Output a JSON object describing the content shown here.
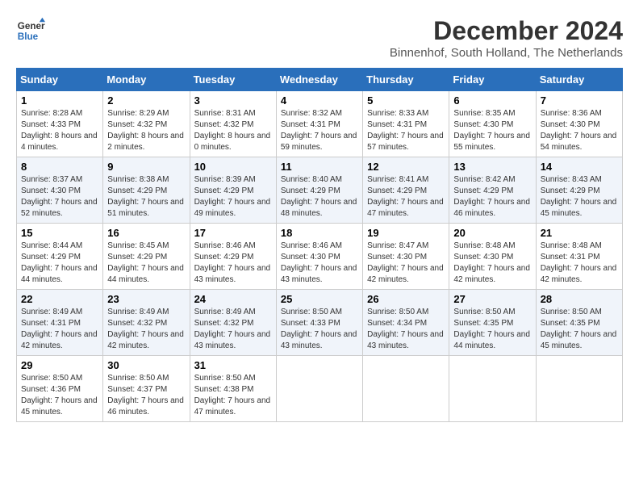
{
  "header": {
    "logo_line1": "General",
    "logo_line2": "Blue",
    "month_title": "December 2024",
    "location": "Binnenhof, South Holland, The Netherlands"
  },
  "weekdays": [
    "Sunday",
    "Monday",
    "Tuesday",
    "Wednesday",
    "Thursday",
    "Friday",
    "Saturday"
  ],
  "weeks": [
    [
      {
        "day": "1",
        "sunrise": "8:28 AM",
        "sunset": "4:33 PM",
        "daylight": "8 hours and 4 minutes."
      },
      {
        "day": "2",
        "sunrise": "8:29 AM",
        "sunset": "4:32 PM",
        "daylight": "8 hours and 2 minutes."
      },
      {
        "day": "3",
        "sunrise": "8:31 AM",
        "sunset": "4:32 PM",
        "daylight": "8 hours and 0 minutes."
      },
      {
        "day": "4",
        "sunrise": "8:32 AM",
        "sunset": "4:31 PM",
        "daylight": "7 hours and 59 minutes."
      },
      {
        "day": "5",
        "sunrise": "8:33 AM",
        "sunset": "4:31 PM",
        "daylight": "7 hours and 57 minutes."
      },
      {
        "day": "6",
        "sunrise": "8:35 AM",
        "sunset": "4:30 PM",
        "daylight": "7 hours and 55 minutes."
      },
      {
        "day": "7",
        "sunrise": "8:36 AM",
        "sunset": "4:30 PM",
        "daylight": "7 hours and 54 minutes."
      }
    ],
    [
      {
        "day": "8",
        "sunrise": "8:37 AM",
        "sunset": "4:30 PM",
        "daylight": "7 hours and 52 minutes."
      },
      {
        "day": "9",
        "sunrise": "8:38 AM",
        "sunset": "4:29 PM",
        "daylight": "7 hours and 51 minutes."
      },
      {
        "day": "10",
        "sunrise": "8:39 AM",
        "sunset": "4:29 PM",
        "daylight": "7 hours and 49 minutes."
      },
      {
        "day": "11",
        "sunrise": "8:40 AM",
        "sunset": "4:29 PM",
        "daylight": "7 hours and 48 minutes."
      },
      {
        "day": "12",
        "sunrise": "8:41 AM",
        "sunset": "4:29 PM",
        "daylight": "7 hours and 47 minutes."
      },
      {
        "day": "13",
        "sunrise": "8:42 AM",
        "sunset": "4:29 PM",
        "daylight": "7 hours and 46 minutes."
      },
      {
        "day": "14",
        "sunrise": "8:43 AM",
        "sunset": "4:29 PM",
        "daylight": "7 hours and 45 minutes."
      }
    ],
    [
      {
        "day": "15",
        "sunrise": "8:44 AM",
        "sunset": "4:29 PM",
        "daylight": "7 hours and 44 minutes."
      },
      {
        "day": "16",
        "sunrise": "8:45 AM",
        "sunset": "4:29 PM",
        "daylight": "7 hours and 44 minutes."
      },
      {
        "day": "17",
        "sunrise": "8:46 AM",
        "sunset": "4:29 PM",
        "daylight": "7 hours and 43 minutes."
      },
      {
        "day": "18",
        "sunrise": "8:46 AM",
        "sunset": "4:30 PM",
        "daylight": "7 hours and 43 minutes."
      },
      {
        "day": "19",
        "sunrise": "8:47 AM",
        "sunset": "4:30 PM",
        "daylight": "7 hours and 42 minutes."
      },
      {
        "day": "20",
        "sunrise": "8:48 AM",
        "sunset": "4:30 PM",
        "daylight": "7 hours and 42 minutes."
      },
      {
        "day": "21",
        "sunrise": "8:48 AM",
        "sunset": "4:31 PM",
        "daylight": "7 hours and 42 minutes."
      }
    ],
    [
      {
        "day": "22",
        "sunrise": "8:49 AM",
        "sunset": "4:31 PM",
        "daylight": "7 hours and 42 minutes."
      },
      {
        "day": "23",
        "sunrise": "8:49 AM",
        "sunset": "4:32 PM",
        "daylight": "7 hours and 42 minutes."
      },
      {
        "day": "24",
        "sunrise": "8:49 AM",
        "sunset": "4:32 PM",
        "daylight": "7 hours and 43 minutes."
      },
      {
        "day": "25",
        "sunrise": "8:50 AM",
        "sunset": "4:33 PM",
        "daylight": "7 hours and 43 minutes."
      },
      {
        "day": "26",
        "sunrise": "8:50 AM",
        "sunset": "4:34 PM",
        "daylight": "7 hours and 43 minutes."
      },
      {
        "day": "27",
        "sunrise": "8:50 AM",
        "sunset": "4:35 PM",
        "daylight": "7 hours and 44 minutes."
      },
      {
        "day": "28",
        "sunrise": "8:50 AM",
        "sunset": "4:35 PM",
        "daylight": "7 hours and 45 minutes."
      }
    ],
    [
      {
        "day": "29",
        "sunrise": "8:50 AM",
        "sunset": "4:36 PM",
        "daylight": "7 hours and 45 minutes."
      },
      {
        "day": "30",
        "sunrise": "8:50 AM",
        "sunset": "4:37 PM",
        "daylight": "7 hours and 46 minutes."
      },
      {
        "day": "31",
        "sunrise": "8:50 AM",
        "sunset": "4:38 PM",
        "daylight": "7 hours and 47 minutes."
      },
      null,
      null,
      null,
      null
    ]
  ]
}
